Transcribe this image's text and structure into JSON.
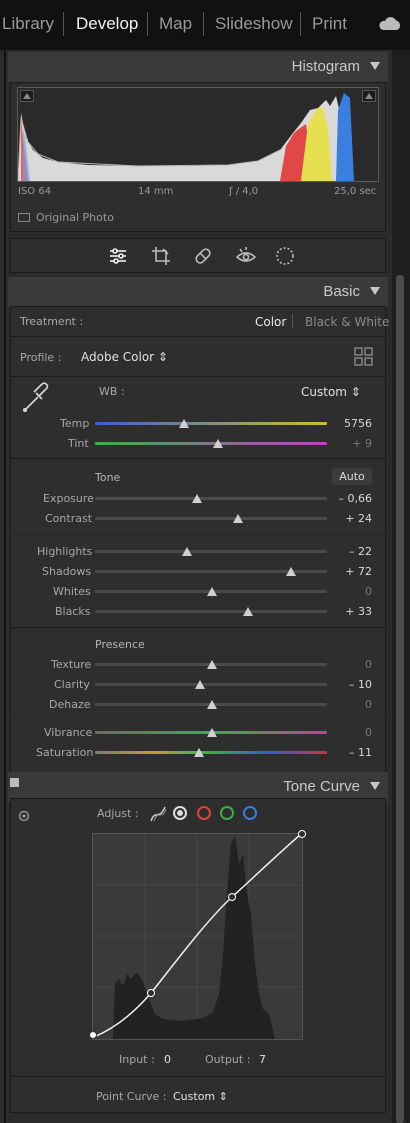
{
  "nav": {
    "items": [
      "Library",
      "Develop",
      "Map",
      "Slideshow",
      "Print"
    ],
    "active": "Develop"
  },
  "histogram": {
    "title": "Histogram",
    "iso": "ISO 64",
    "focal": "14 mm",
    "aperture": "ƒ / 4,0",
    "shutter": "25,0 sec",
    "original_photo": "Original Photo"
  },
  "basic": {
    "title": "Basic",
    "treatment_label": "Treatment :",
    "treatment_color": "Color",
    "treatment_bw": "Black & White",
    "profile_label": "Profile :",
    "profile_value": "Adobe Color ⇕",
    "wb_label": "WB :",
    "wb_value": "Custom ⇕",
    "tone_label": "Tone",
    "auto_label": "Auto",
    "presence_label": "Presence",
    "sliders": [
      {
        "label": "Temp",
        "value": "5756",
        "pos": 0.38
      },
      {
        "label": "Tint",
        "value": "+ 9",
        "pos": 0.53
      },
      {
        "label": "Exposure",
        "value": "– 0,66",
        "pos": 0.44
      },
      {
        "label": "Contrast",
        "value": "+ 24",
        "pos": 0.62
      },
      {
        "label": "Highlights",
        "value": "– 22",
        "pos": 0.39
      },
      {
        "label": "Shadows",
        "value": "+ 72",
        "pos": 0.86
      },
      {
        "label": "Whites",
        "value": "0",
        "pos": 0.5
      },
      {
        "label": "Blacks",
        "value": "+ 33",
        "pos": 0.66
      },
      {
        "label": "Texture",
        "value": "0",
        "pos": 0.5
      },
      {
        "label": "Clarity",
        "value": "– 10",
        "pos": 0.45
      },
      {
        "label": "Dehaze",
        "value": "0",
        "pos": 0.5
      },
      {
        "label": "Vibrance",
        "value": "0",
        "pos": 0.5
      },
      {
        "label": "Saturation",
        "value": "– 11",
        "pos": 0.45
      }
    ]
  },
  "tone_curve": {
    "title": "Tone Curve",
    "adjust_label": "Adjust :",
    "input_label": "Input :",
    "input_value": "0",
    "output_label": "Output :",
    "output_value": "7",
    "point_curve_label": "Point Curve :",
    "point_curve_value": "Custom ⇕"
  },
  "colors": {
    "accent_red": "#e0403a",
    "accent_green": "#3fae48",
    "accent_blue": "#3a7ee0"
  }
}
